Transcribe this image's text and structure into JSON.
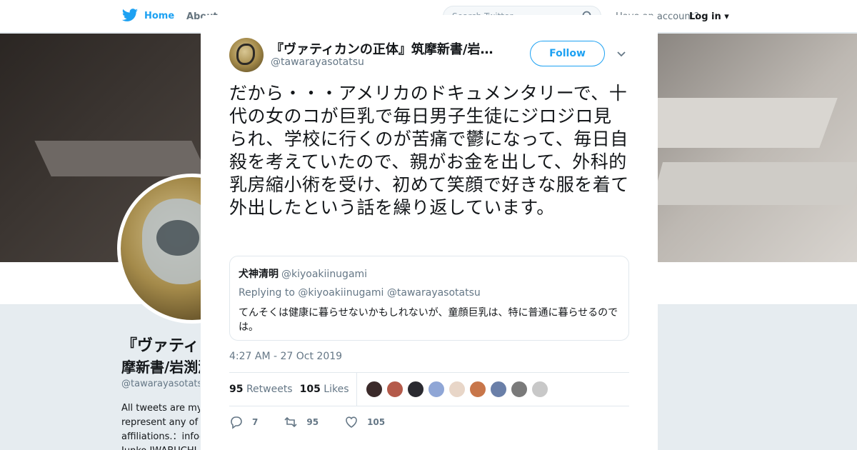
{
  "nav": {
    "home_label": "Home",
    "about_label": "About",
    "search_placeholder": "Search Twitter",
    "account_prompt": "Have an account?",
    "login_label": "Log in"
  },
  "profile": {
    "name_line1": "『ヴァティカンの正体』筑",
    "name_line2": "摩新書/岩渕潤子",
    "handle": "@tawarayasotatsu",
    "bio_lines": [
      "All tweets are my own views and do not",
      "represent any of my",
      "affiliations.：info@",
      "Junko IWABUCHI"
    ]
  },
  "tweet": {
    "author_name": "『ヴァティカンの正体』筑摩新書/岩…",
    "author_handle": "@tawarayasotatsu",
    "follow_label": "Follow",
    "text": "だから・・・アメリカのドキュメンタリーで、十代の女のコが巨乳で毎日男子生徒にジロジロ見られ、学校に行くのが苦痛で鬱になって、毎日自殺を考えていたので、親がお金を出して、外科的乳房縮小術を受け、初めて笑顔で好きな服を着て外出したという話を繰り返しています。",
    "quote": {
      "name": "犬神清明",
      "handle": "@kiyoakiinugami",
      "replying_to": "Replying to @kiyoakiinugami @tawarayasotatsu",
      "text": "てんそくは健康に暮らせないかもしれないが、童顔巨乳は、特に普通に暮らせるのでは。"
    },
    "timestamp": "4:27 AM - 27 Oct 2019",
    "retweets_count": "95",
    "retweets_label": "Retweets",
    "likes_count": "105",
    "likes_label": "Likes",
    "liker_colors": [
      "#3b2a2a",
      "#b45a4a",
      "#2a2a30",
      "#8fa6d6",
      "#e8d6c8",
      "#c8764a",
      "#6a7fa8",
      "#7a7a7a",
      "#c8c8c8"
    ],
    "reply_count": "7",
    "retweet_action_count": "95",
    "like_action_count": "105"
  },
  "colors": {
    "brand": "#1da1f2",
    "text": "#14171a",
    "muted": "#657786"
  }
}
